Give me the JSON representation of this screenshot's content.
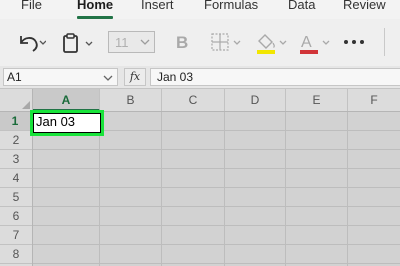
{
  "ribbon": {
    "tabs": [
      {
        "label": "File"
      },
      {
        "label": "Home"
      },
      {
        "label": "Insert"
      },
      {
        "label": "Formulas"
      },
      {
        "label": "Data"
      },
      {
        "label": "Review"
      }
    ],
    "active_tab": "Home",
    "accent_color": "#217346"
  },
  "toolbar": {
    "font_size_value": "11",
    "icons": [
      "undo-icon",
      "paste-icon",
      "bold-icon",
      "borders-icon",
      "fill-color-icon",
      "font-color-icon",
      "more-icon"
    ],
    "fill_color": "#f2e600",
    "font_color": "#d13438"
  },
  "formula_bar": {
    "name_box": "A1",
    "fx_label": "fx",
    "formula": "Jan 03"
  },
  "grid": {
    "columns": [
      "A",
      "B",
      "C",
      "D",
      "E",
      "F"
    ],
    "rows": [
      "1",
      "2",
      "3",
      "4",
      "5",
      "6",
      "7",
      "8"
    ],
    "selected_cell": {
      "column": "A",
      "row": "1",
      "value": "Jan 03"
    },
    "highlight_color": "#18e33a"
  }
}
